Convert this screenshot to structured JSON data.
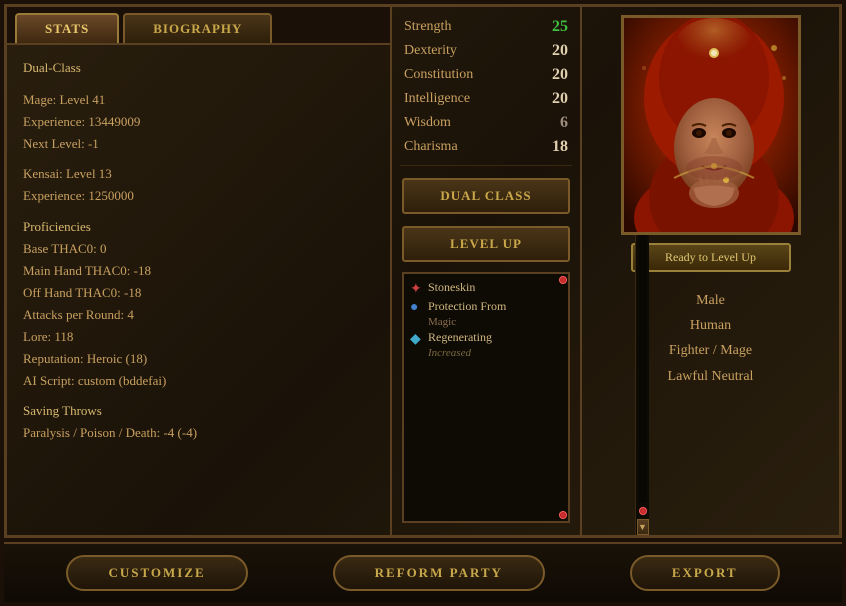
{
  "tabs": {
    "stats_label": "STATS",
    "biography_label": "BIOGRAPHY"
  },
  "stats_text": {
    "class_type": "Dual-Class",
    "mage_level": "Mage: Level 41",
    "mage_exp": "Experience: 13449009",
    "mage_next": "Next Level: -1",
    "kensai_level": "Kensai: Level 13",
    "kensai_exp": "Experience: 1250000",
    "proficiencies_header": "Proficiencies",
    "base_thac0": "Base THAC0: 0",
    "main_hand_thac0": "Main Hand THAC0: -18",
    "off_hand_thac0": "Off Hand THAC0: -18",
    "attacks_per_round": "Attacks per Round: 4",
    "lore": "Lore: 118",
    "reputation": "Reputation:  Heroic (18)",
    "ai_script": "AI Script: custom (bddefai)",
    "saving_throws_header": "Saving Throws",
    "paralysis": "Paralysis / Poison / Death: -4 (-4)"
  },
  "attributes": [
    {
      "name": "Strength",
      "value": "25",
      "color": "green"
    },
    {
      "name": "Dexterity",
      "value": "20",
      "color": "white"
    },
    {
      "name": "Constitution",
      "value": "20",
      "color": "white"
    },
    {
      "name": "Intelligence",
      "value": "20",
      "color": "white"
    },
    {
      "name": "Wisdom",
      "value": "6",
      "color": "dark"
    },
    {
      "name": "Charisma",
      "value": "18",
      "color": "white"
    }
  ],
  "buttons": {
    "dual_class": "DUAL CLASS",
    "level_up": "LEVEL UP"
  },
  "abilities": [
    {
      "icon": "✦",
      "icon_type": "red",
      "name": "Stoneskin"
    },
    {
      "icon": "●",
      "icon_type": "blue",
      "name": "Protection From"
    },
    {
      "sub": "Magic"
    },
    {
      "icon": "◆",
      "icon_type": "teal",
      "name": "Regenerating"
    },
    {
      "note": "Increased"
    }
  ],
  "portrait": {
    "level_up_text": "Ready to Level Up"
  },
  "char_info": {
    "gender": "Male",
    "race": "Human",
    "class": "Fighter / Mage",
    "alignment": "Lawful Neutral"
  },
  "bottom_buttons": {
    "customize": "CUSTOMIZE",
    "reform_party": "REFORM PARTY",
    "export": "EXPORT"
  }
}
